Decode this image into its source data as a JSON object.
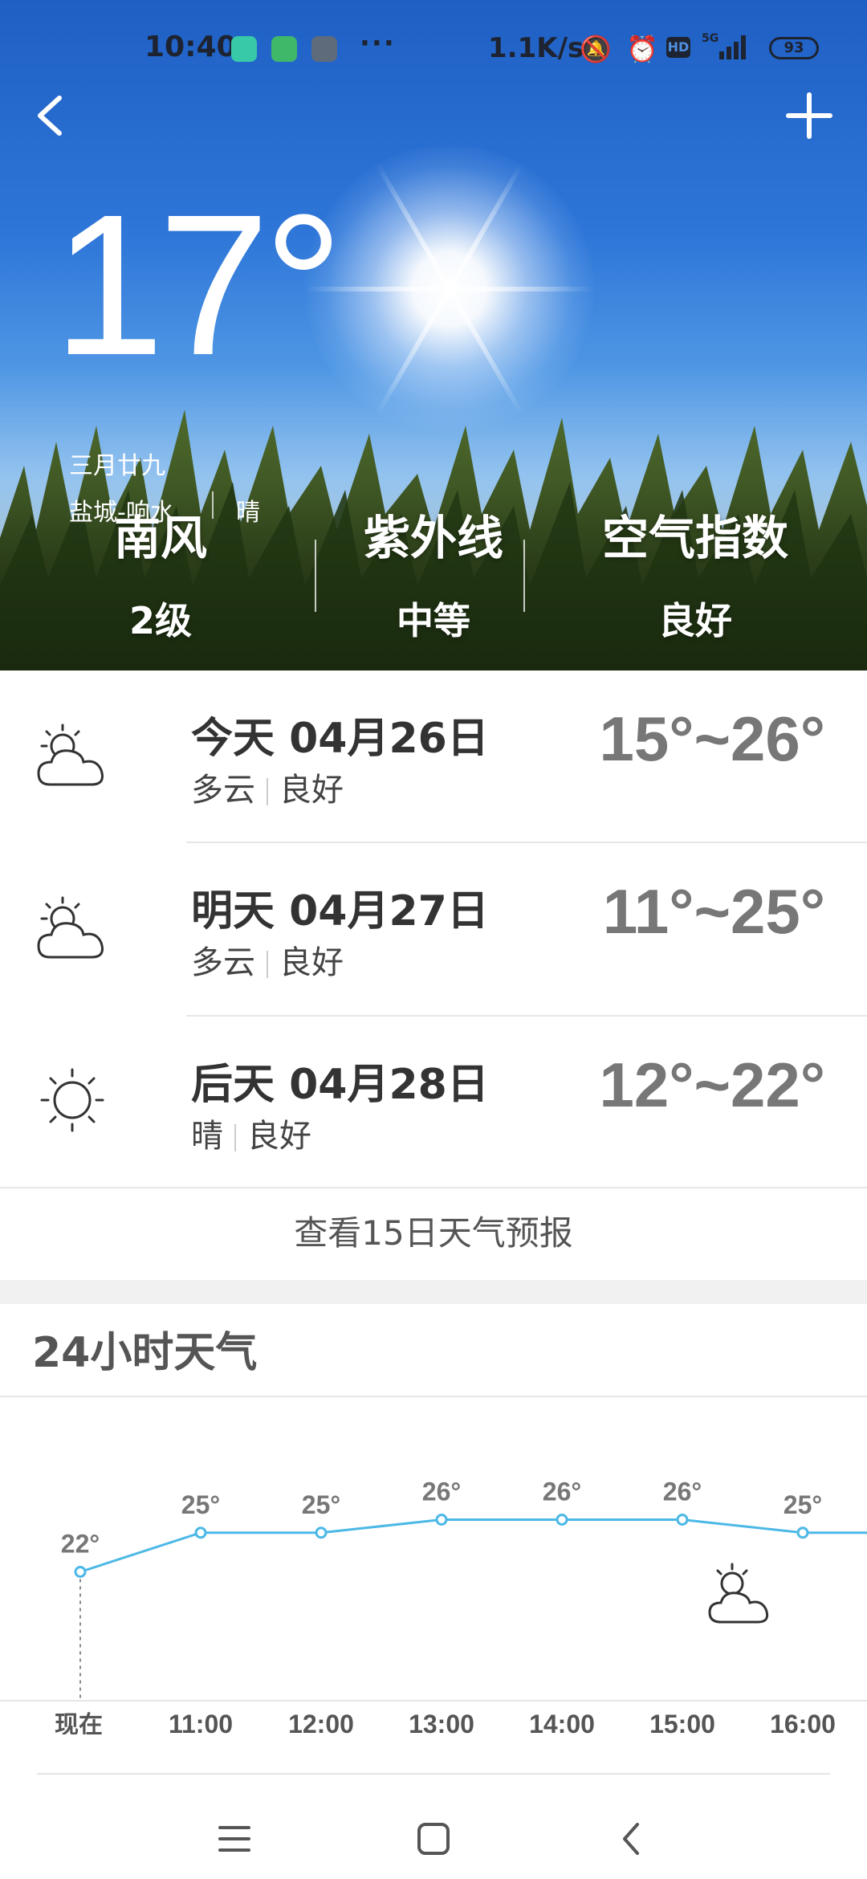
{
  "status_bar": {
    "time": "10:40",
    "net_speed": "1.1K/s",
    "hd": "HD",
    "network": "5G",
    "battery": "93"
  },
  "current": {
    "temperature": "17°",
    "lunar_date": "三月廿九",
    "location": "盐城-响水",
    "condition": "晴"
  },
  "metrics": [
    {
      "title": "南风",
      "value": "2级"
    },
    {
      "title": "紫外线",
      "value": "中等"
    },
    {
      "title": "空气指数",
      "value": "良好"
    }
  ],
  "forecast": [
    {
      "day": "今天",
      "date": "04月26日",
      "weather": "多云",
      "air": "良好",
      "range": "15°~26°",
      "icon": "partly-cloudy-icon"
    },
    {
      "day": "明天",
      "date": "04月27日",
      "weather": "多云",
      "air": "良好",
      "range": "11°~25°",
      "icon": "partly-cloudy-icon"
    },
    {
      "day": "后天",
      "date": "04月28日",
      "weather": "晴",
      "air": "良好",
      "range": "12°~22°",
      "icon": "sunny-icon"
    }
  ],
  "more_forecast_label": "查看15日天气预报",
  "hourly_title": "24小时天气",
  "chart_data": {
    "type": "line",
    "categories": [
      "现在",
      "11:00",
      "12:00",
      "13:00",
      "14:00",
      "15:00",
      "16:00"
    ],
    "values": [
      22,
      25,
      25,
      26,
      26,
      26,
      25
    ],
    "value_labels": [
      "22°",
      "25°",
      "25°",
      "26°",
      "26°",
      "26°",
      "25°"
    ],
    "line_color": "#4cb8e6",
    "ylim": [
      20,
      28
    ],
    "grid": false
  },
  "colors": {
    "accent_line": "#4cb8e6",
    "temp_range": "#777777",
    "sky_top": "#1f5fc4"
  },
  "nav": {
    "menu_icon": "menu-icon",
    "home_icon": "home-icon",
    "back_icon": "back-icon"
  }
}
